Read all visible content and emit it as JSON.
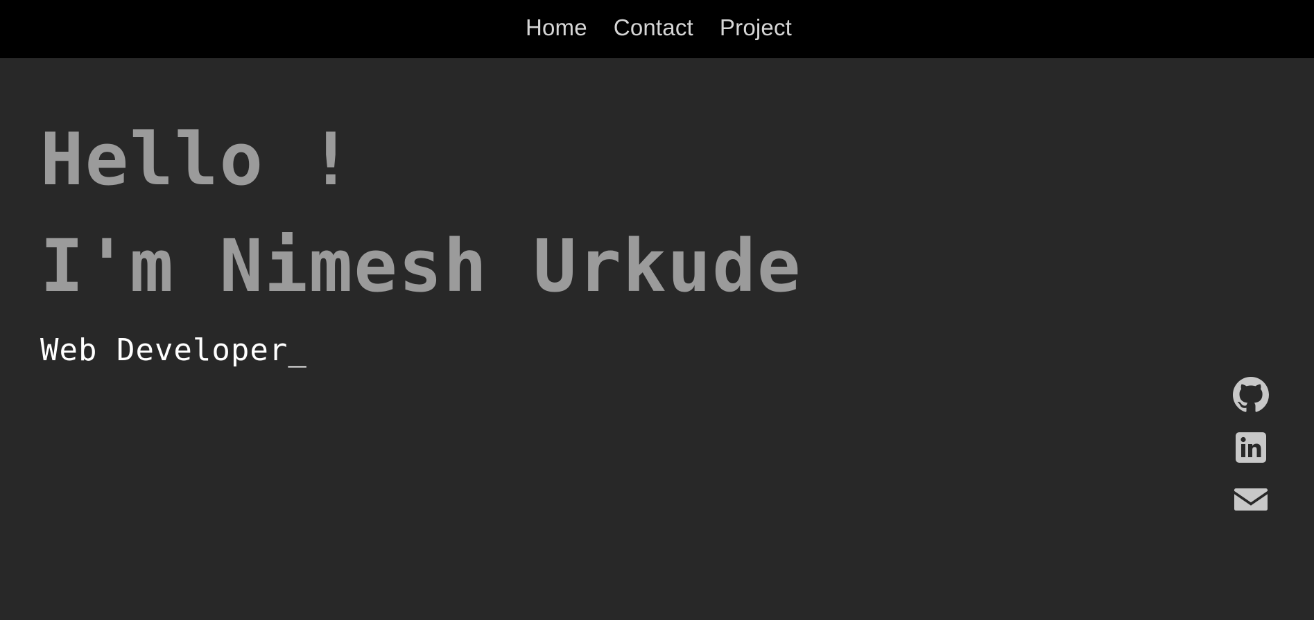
{
  "nav": {
    "items": [
      {
        "label": "Home"
      },
      {
        "label": "Contact"
      },
      {
        "label": "Project"
      }
    ]
  },
  "hero": {
    "greeting": "Hello !",
    "name_line": "I'm Nimesh Urkude",
    "role": "Web Developer_"
  },
  "social": {
    "icons": [
      "github-icon",
      "linkedin-icon",
      "mail-icon"
    ]
  },
  "colors": {
    "background": "#282828",
    "topbar": "#000000",
    "heading": "#9b9b9b",
    "nav_text": "#d6d6d6",
    "icon": "#c8c8c8"
  }
}
